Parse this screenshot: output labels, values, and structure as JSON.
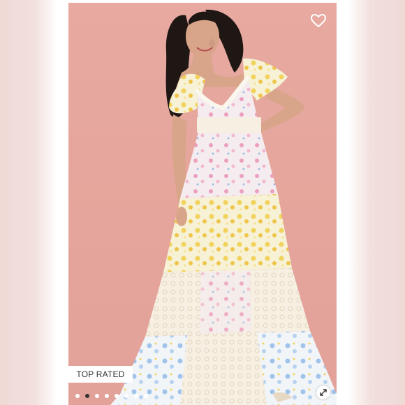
{
  "listing": {
    "badge": "TOP RATED",
    "icons": {
      "favorite": "heart-icon",
      "expand": "expand-icon"
    },
    "carousel": {
      "total": 8,
      "current": 2
    },
    "colors": {
      "background": "#e6a79e",
      "badge_text": "#333333",
      "active_dot": "#333333",
      "inactive_dot": "#ffffff"
    }
  }
}
